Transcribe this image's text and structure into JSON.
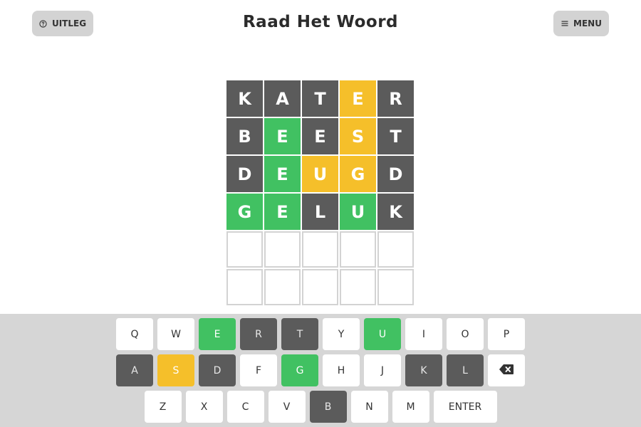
{
  "header": {
    "help_label": "UITLEG",
    "title": "Raad Het Woord",
    "menu_label": "MENU"
  },
  "colors": {
    "absent": "#5b5b5b",
    "present": "#f5bf2a",
    "correct": "#41c162",
    "keyboard_bg": "#d6d6d6"
  },
  "board": {
    "rows": [
      [
        {
          "letter": "K",
          "state": "absent"
        },
        {
          "letter": "A",
          "state": "absent"
        },
        {
          "letter": "T",
          "state": "absent"
        },
        {
          "letter": "E",
          "state": "present"
        },
        {
          "letter": "R",
          "state": "absent"
        }
      ],
      [
        {
          "letter": "B",
          "state": "absent"
        },
        {
          "letter": "E",
          "state": "correct"
        },
        {
          "letter": "E",
          "state": "absent"
        },
        {
          "letter": "S",
          "state": "present"
        },
        {
          "letter": "T",
          "state": "absent"
        }
      ],
      [
        {
          "letter": "D",
          "state": "absent"
        },
        {
          "letter": "E",
          "state": "correct"
        },
        {
          "letter": "U",
          "state": "present"
        },
        {
          "letter": "G",
          "state": "present"
        },
        {
          "letter": "D",
          "state": "absent"
        }
      ],
      [
        {
          "letter": "G",
          "state": "correct"
        },
        {
          "letter": "E",
          "state": "correct"
        },
        {
          "letter": "L",
          "state": "absent"
        },
        {
          "letter": "U",
          "state": "correct"
        },
        {
          "letter": "K",
          "state": "absent"
        }
      ],
      [
        {
          "letter": "",
          "state": "empty"
        },
        {
          "letter": "",
          "state": "empty"
        },
        {
          "letter": "",
          "state": "empty"
        },
        {
          "letter": "",
          "state": "empty"
        },
        {
          "letter": "",
          "state": "empty"
        }
      ],
      [
        {
          "letter": "",
          "state": "empty"
        },
        {
          "letter": "",
          "state": "empty"
        },
        {
          "letter": "",
          "state": "empty"
        },
        {
          "letter": "",
          "state": "empty"
        },
        {
          "letter": "",
          "state": "empty"
        }
      ]
    ]
  },
  "keyboard": {
    "rows": [
      [
        {
          "label": "Q",
          "state": "unused"
        },
        {
          "label": "W",
          "state": "unused"
        },
        {
          "label": "E",
          "state": "correct"
        },
        {
          "label": "R",
          "state": "absent"
        },
        {
          "label": "T",
          "state": "absent"
        },
        {
          "label": "Y",
          "state": "unused"
        },
        {
          "label": "U",
          "state": "correct"
        },
        {
          "label": "I",
          "state": "unused"
        },
        {
          "label": "O",
          "state": "unused"
        },
        {
          "label": "P",
          "state": "unused"
        }
      ],
      [
        {
          "label": "A",
          "state": "absent"
        },
        {
          "label": "S",
          "state": "present"
        },
        {
          "label": "D",
          "state": "absent"
        },
        {
          "label": "F",
          "state": "unused"
        },
        {
          "label": "G",
          "state": "correct"
        },
        {
          "label": "H",
          "state": "unused"
        },
        {
          "label": "J",
          "state": "unused"
        },
        {
          "label": "K",
          "state": "absent"
        },
        {
          "label": "L",
          "state": "absent"
        },
        {
          "label": "",
          "state": "unused",
          "icon": "backspace-icon"
        }
      ],
      [
        {
          "label": "Z",
          "state": "unused"
        },
        {
          "label": "X",
          "state": "unused"
        },
        {
          "label": "C",
          "state": "unused"
        },
        {
          "label": "V",
          "state": "unused"
        },
        {
          "label": "B",
          "state": "absent"
        },
        {
          "label": "N",
          "state": "unused"
        },
        {
          "label": "M",
          "state": "unused"
        },
        {
          "label": "ENTER",
          "state": "unused",
          "wide": true
        }
      ]
    ]
  }
}
